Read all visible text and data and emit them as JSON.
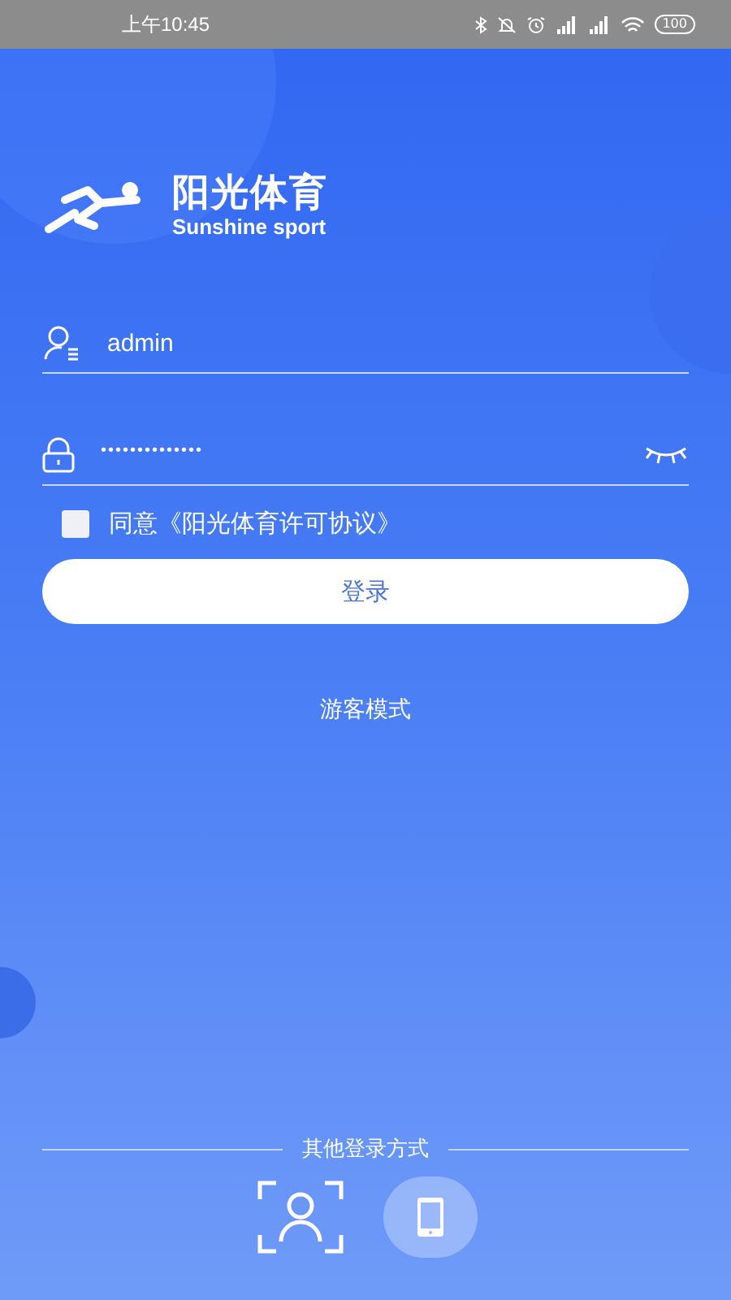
{
  "status_bar": {
    "time": "上午10:45",
    "battery": "100"
  },
  "brand": {
    "name": "阳光体育",
    "subtitle": "Sunshine sport"
  },
  "username": {
    "value": "admin"
  },
  "password": {
    "value": "••••••••••••••",
    "visible": false
  },
  "agreement": {
    "checked": false,
    "label": "同意《阳光体育许可协议》"
  },
  "login_button": "登录",
  "guest_link": "游客模式",
  "other_login": {
    "title": "其他登录方式",
    "methods": [
      {
        "kind": "face",
        "selected": false
      },
      {
        "kind": "phone",
        "selected": true
      }
    ]
  }
}
